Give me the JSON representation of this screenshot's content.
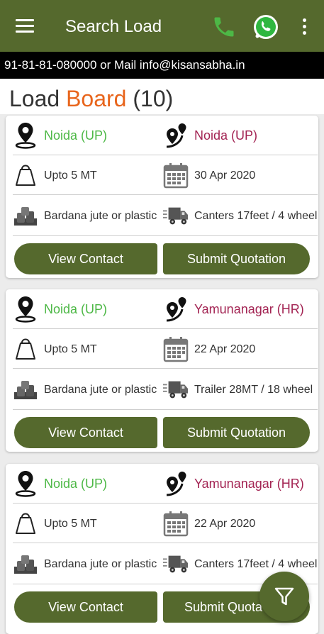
{
  "appbar": {
    "title": "Search Load",
    "icons": [
      "menu-icon",
      "phone-icon",
      "whatsapp-icon",
      "more-vert-icon"
    ]
  },
  "ticker": {
    "text": "91-81-81-080000 or Mail info@kisansabha.in"
  },
  "board": {
    "title_part1": "Load",
    "title_part2": "Board",
    "count": "(10)"
  },
  "colors": {
    "primary": "#55692d",
    "accent": "#e8651c",
    "from": "#4db846",
    "to": "#a32453"
  },
  "loads": [
    {
      "from": "Noida (UP)",
      "to": "Noida (UP)",
      "weight": "Upto 5 MT",
      "date": "30 Apr 2020",
      "material": "Bardana jute or plastic",
      "vehicle": "Canters 17feet / 4 wheel",
      "view_label": "View Contact",
      "submit_label": "Submit Quotation"
    },
    {
      "from": "Noida (UP)",
      "to": "Yamunanagar (HR)",
      "weight": "Upto 5 MT",
      "date": "22 Apr 2020",
      "material": "Bardana jute or plastic",
      "vehicle": "Trailer 28MT / 18 wheel",
      "view_label": "View Contact",
      "submit_label": "Submit Quotation"
    },
    {
      "from": "Noida (UP)",
      "to": "Yamunanagar (HR)",
      "weight": "Upto 5 MT",
      "date": "22 Apr 2020",
      "material": "Bardana jute or plastic",
      "vehicle": "Canters 17feet / 4 wheel",
      "view_label": "View Contact",
      "submit_label": "Submit Quota"
    }
  ],
  "fab": {
    "icon": "filter-icon"
  }
}
